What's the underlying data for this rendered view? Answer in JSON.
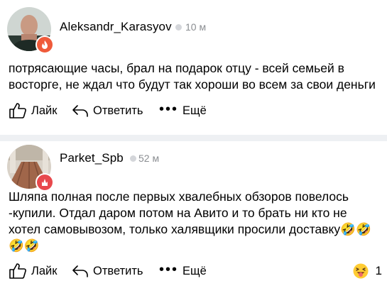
{
  "comments": [
    {
      "author": "Aleksandr_Karasyov",
      "time": "10 м",
      "text": "потрясающие часы, брал на подарок отцу - всей семьей в\nвосторге, не ждал что будут так хороши во всем за свои деньги",
      "actions": {
        "like": "Лайк",
        "reply": "Ответить",
        "more": "Ещё"
      },
      "badge_color": "#ef5a3a"
    },
    {
      "author": "Parket_Spb",
      "time": "52 м",
      "text": "Шляпа полная после первых хвалебных обзоров повелось\n-купили. Отдал даром потом на Авито и то брать ни кто не\nхотел самовывозом, только халявщики просили доставку🤣🤣\n🤣🤣",
      "actions": {
        "like": "Лайк",
        "reply": "Ответить",
        "more": "Ещё"
      },
      "badge_color": "#e8484c",
      "reaction": {
        "icon": "squinting-tongue-face-icon",
        "count": "1"
      }
    }
  ],
  "ui": {
    "more_dots": "•••"
  }
}
